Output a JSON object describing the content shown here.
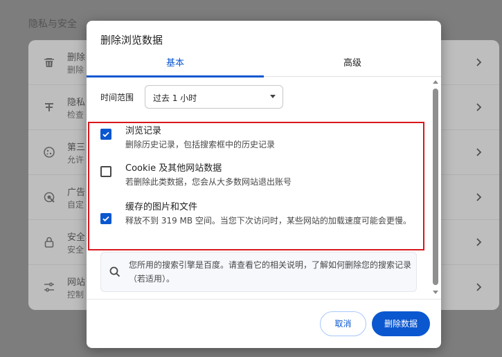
{
  "background": {
    "section_title": "隐私与安全",
    "rows": [
      {
        "icon": "trash-icon",
        "title": "删除",
        "subtitle": "删除"
      },
      {
        "icon": "privacy-guide-icon",
        "title": "隐私",
        "subtitle": "检查"
      },
      {
        "icon": "cookie-icon",
        "title": "第三",
        "subtitle": "允许"
      },
      {
        "icon": "ad-privacy-icon",
        "title": "广告",
        "subtitle": "自定"
      },
      {
        "icon": "lock-icon",
        "title": "安全",
        "subtitle": "安全"
      },
      {
        "icon": "sliders-icon",
        "title": "网站",
        "subtitle": "控制"
      }
    ]
  },
  "dialog": {
    "title": "删除浏览数据",
    "tabs": [
      {
        "label": "基本",
        "active": true
      },
      {
        "label": "高级",
        "active": false
      }
    ],
    "time_range": {
      "label": "时间范围",
      "selected": "过去 1 小时"
    },
    "options": [
      {
        "title": "浏览记录",
        "subtitle": "删除历史记录，包括搜索框中的历史记录",
        "checked": true
      },
      {
        "title": "Cookie 及其他网站数据",
        "subtitle": "若删除此类数据，您会从大多数网站退出账号",
        "checked": false
      },
      {
        "title": "缓存的图片和文件",
        "subtitle": "释放不到 319 MB 空间。当您下次访问时，某些网站的加载速度可能会更慢。",
        "checked": true
      }
    ],
    "info": {
      "icon": "search-icon",
      "text": "您所用的搜索引擎是百度。请查看它的相关说明，了解如何删除您的搜索记录（若适用）。"
    },
    "buttons": {
      "cancel": "取消",
      "confirm": "删除数据"
    }
  },
  "colors": {
    "accent": "#0b57d0",
    "highlight": "#d9161c",
    "overlay": "#7d7d7d"
  }
}
